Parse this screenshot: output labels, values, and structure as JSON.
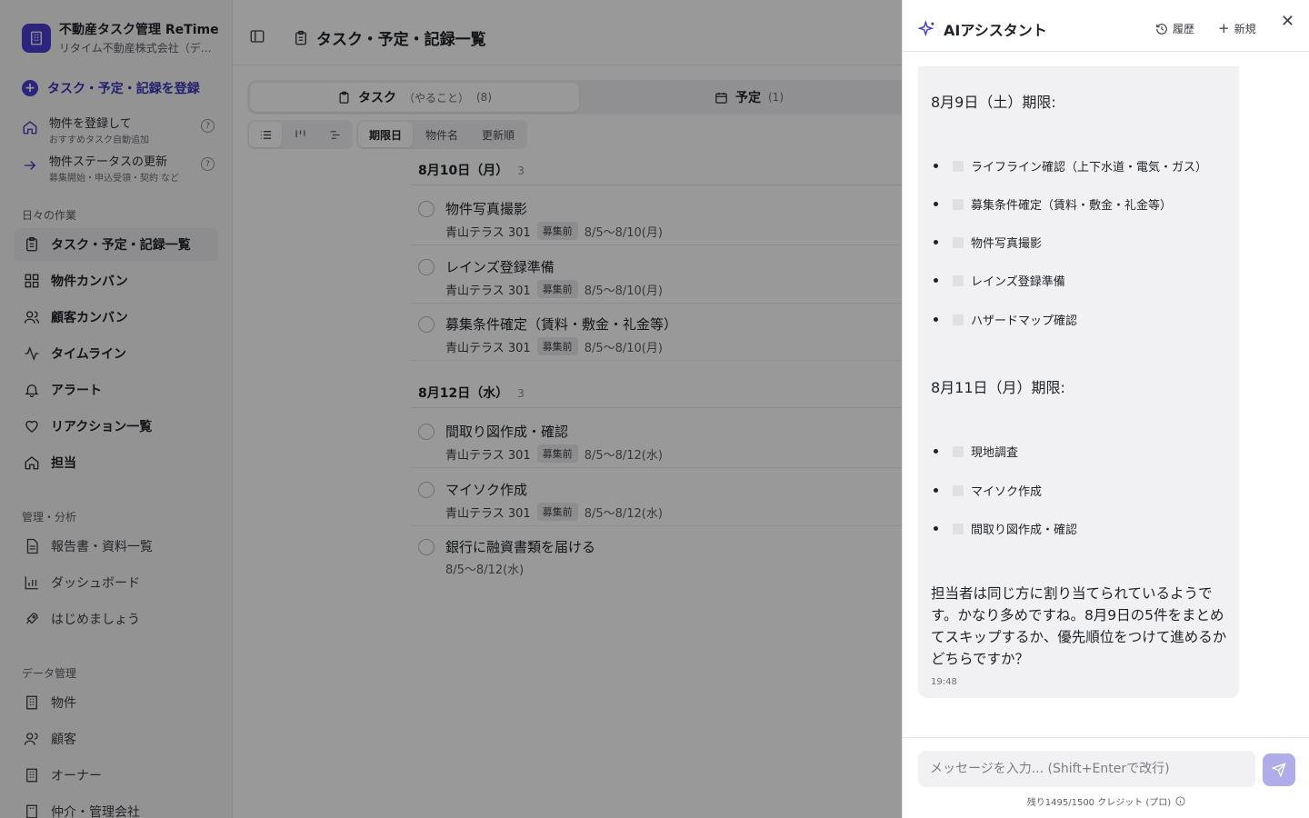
{
  "app": {
    "name": "不動産タスク管理 ReTime",
    "company": "リタイム不動産株式会社（デモ）"
  },
  "sidebar": {
    "primary_action": "タスク・予定・記録を登録",
    "secondary_actions": [
      {
        "label": "物件を登録して",
        "sub": "おすすめタスク自動追加"
      },
      {
        "label": "物件ステータスの更新",
        "sub": "募集開始・申込受領・契約 など"
      }
    ],
    "sections": [
      {
        "heading": "日々の作業",
        "items": [
          "タスク・予定・記録一覧",
          "物件カンバン",
          "顧客カンバン",
          "タイムライン",
          "アラート",
          "リアクション一覧",
          "担当"
        ]
      },
      {
        "heading": "管理・分析",
        "items": [
          "報告書・資料一覧",
          "ダッシュボード",
          "はじめましょう"
        ]
      },
      {
        "heading": "データ管理",
        "items": [
          "物件",
          "顧客",
          "オーナー",
          "仲介・管理会社"
        ]
      }
    ]
  },
  "main": {
    "title": "タスク・予定・記録一覧",
    "tabs": [
      {
        "label": "タスク",
        "sub": "（やること）",
        "count": "(8)"
      },
      {
        "label": "予定",
        "count": "(1)"
      }
    ],
    "sort_options": [
      "期限日",
      "物件名",
      "更新順"
    ],
    "groups": [
      {
        "date": "8月10日（月）",
        "count": "3",
        "tasks": [
          {
            "name": "物件写真撮影",
            "property": "青山テラス 301",
            "badge": "募集前",
            "range": "8/5〜8/10(月)"
          },
          {
            "name": "レインズ登録準備",
            "property": "青山テラス 301",
            "badge": "募集前",
            "range": "8/5〜8/10(月)"
          },
          {
            "name": "募集条件確定（賃料・敷金・礼金等）",
            "property": "青山テラス 301",
            "badge": "募集前",
            "range": "8/5〜8/10(月)"
          }
        ]
      },
      {
        "date": "8月12日（水）",
        "count": "3",
        "tasks": [
          {
            "name": "間取り図作成・確認",
            "property": "青山テラス 301",
            "badge": "募集前",
            "range": "8/5〜8/12(水)"
          },
          {
            "name": "マイソク作成",
            "property": "青山テラス 301",
            "badge": "募集前",
            "range": "8/5〜8/12(水)"
          },
          {
            "name": "銀行に融資書類を届ける",
            "property": "",
            "badge": "",
            "range": "8/5〜8/12(水)"
          }
        ]
      }
    ]
  },
  "assistant": {
    "title": "AIアシスタント",
    "history_label": "履歴",
    "new_label": "新規",
    "message": {
      "section1_title": "8月9日（土）期限:",
      "section1_items": [
        "ライフライン確認（上下水道・電気・ガス）",
        "募集条件確定（賃料・敷金・礼金等）",
        "物件写真撮影",
        "レインズ登録準備",
        "ハザードマップ確認"
      ],
      "section2_title": "8月11日（月）期限:",
      "section2_items": [
        "現地調査",
        "マイソク作成",
        "間取り図作成・確認"
      ],
      "closing": "担当者は同じ方に割り当てられているようです。かなり多めですね。8月9日の5件をまとめてスキップするか、優先順位をつけて進めるかどちらですか？",
      "time": "19:48"
    },
    "input_placeholder": "メッセージを入力... (Shift+Enterで改行)",
    "credits": "残り1495/1500 クレジット (プロ)"
  },
  "colors": {
    "accent": "#4b3fd1",
    "send_button": "#b0abe9",
    "overlay": "rgba(0,0,0,0.40)"
  }
}
